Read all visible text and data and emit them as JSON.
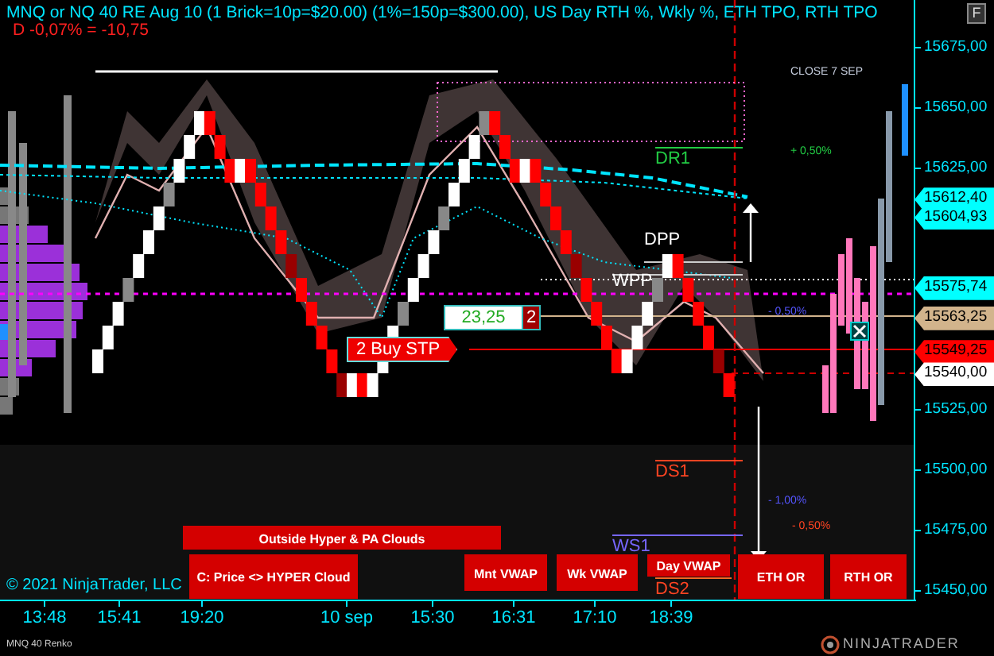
{
  "title": "MNQ or NQ 40 RE Aug 10 (1 Brick=10p=$20.00) (1%=150p=$300.00), US Day RTH %, Wkly %, ETH TPO, RTH TPO",
  "change": "D -0,07% = -10,75",
  "corner_button": "F",
  "price_axis": [
    "15675,00",
    "15650,00",
    "15625,00",
    "15525,00",
    "15500,00",
    "15475,00",
    "15450,00"
  ],
  "price_markers": [
    {
      "text": "15612,40",
      "color": "#00ffff"
    },
    {
      "text": "15604,93",
      "color": "#00ffff"
    },
    {
      "text": "15575,74",
      "color": "#00ffff"
    },
    {
      "text": "15563,25",
      "color": "#d2b48c"
    },
    {
      "text": "15549,25",
      "color": "#ff0000"
    },
    {
      "text": "15540,00",
      "color": "#ffffff"
    }
  ],
  "time_axis": [
    "13:48",
    "15:41",
    "19:20",
    "10 sep",
    "15:30",
    "16:31",
    "17:10",
    "18:39"
  ],
  "chart_labels": [
    {
      "text": "CLOSE 7 SEP",
      "color": "#c8d0e0"
    },
    {
      "text": "DR1",
      "color": "#22cc44"
    },
    {
      "text": "+ 0,50%",
      "color": "#22cc44"
    },
    {
      "text": "DPP",
      "color": "#ffffff"
    },
    {
      "text": "WPP",
      "color": "#ffffff"
    },
    {
      "text": "- 0,50%",
      "color": "#5555ff"
    },
    {
      "text": "DS1",
      "color": "#ff4422"
    },
    {
      "text": "- 1,00%",
      "color": "#5555ff"
    },
    {
      "text": "- 0,50%",
      "color": "#ff4422"
    },
    {
      "text": "WS1",
      "color": "#7766ff"
    },
    {
      "text": "DS2",
      "color": "#ff4422"
    }
  ],
  "order": {
    "label": "2 Buy STP"
  },
  "position": {
    "pnl": "23,25",
    "quantity": "2"
  },
  "buttons": [
    {
      "label": "Outside Hyper & PA Clouds"
    },
    {
      "label": "C: Price <> HYPER Cloud"
    },
    {
      "label": "Mnt VWAP"
    },
    {
      "label": "Wk VWAP"
    },
    {
      "label": "Day VWAP"
    },
    {
      "label": "ETH OR"
    },
    {
      "label": "RTH OR"
    }
  ],
  "footer": {
    "copyright": "© 2021 NinjaTrader, LLC",
    "instrument": "MNQ 40 Renko",
    "brand": "NINJATRADER"
  }
}
